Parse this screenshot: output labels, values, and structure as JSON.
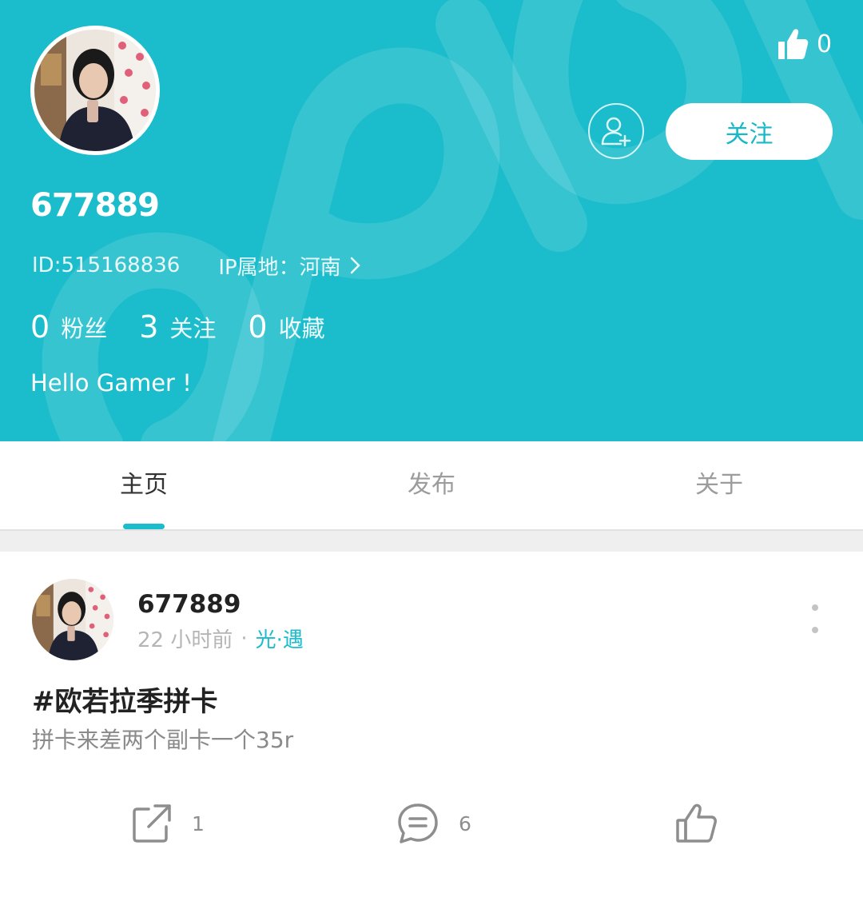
{
  "profile": {
    "like_count": "0",
    "follow_button": "关注",
    "username": "677889",
    "id_text": "ID:515168836",
    "ip_text": "IP属地：河南",
    "stats": [
      {
        "num": "0",
        "label": "粉丝"
      },
      {
        "num": "3",
        "label": "关注"
      },
      {
        "num": "0",
        "label": "收藏"
      }
    ],
    "bio": "Hello Gamer !"
  },
  "tabs": [
    {
      "label": "主页",
      "active": true
    },
    {
      "label": "发布",
      "active": false
    },
    {
      "label": "关于",
      "active": false
    }
  ],
  "post": {
    "author": "677889",
    "time": "22 小时前",
    "separator": "·",
    "tag": "光·遇",
    "title": "#欧若拉季拼卡",
    "body": "拼卡来差两个副卡一个35r",
    "share_count": "1",
    "comment_count": "6",
    "like_count": ""
  },
  "colors": {
    "accent": "#1bbccb",
    "header_bg": "#1bbccb",
    "tag": "#1bbccb"
  },
  "icons": [
    "thumbs-up-icon",
    "add-friend-icon",
    "chevron-right-icon",
    "more-icon",
    "share-icon",
    "comment-icon",
    "like-outline-icon"
  ]
}
